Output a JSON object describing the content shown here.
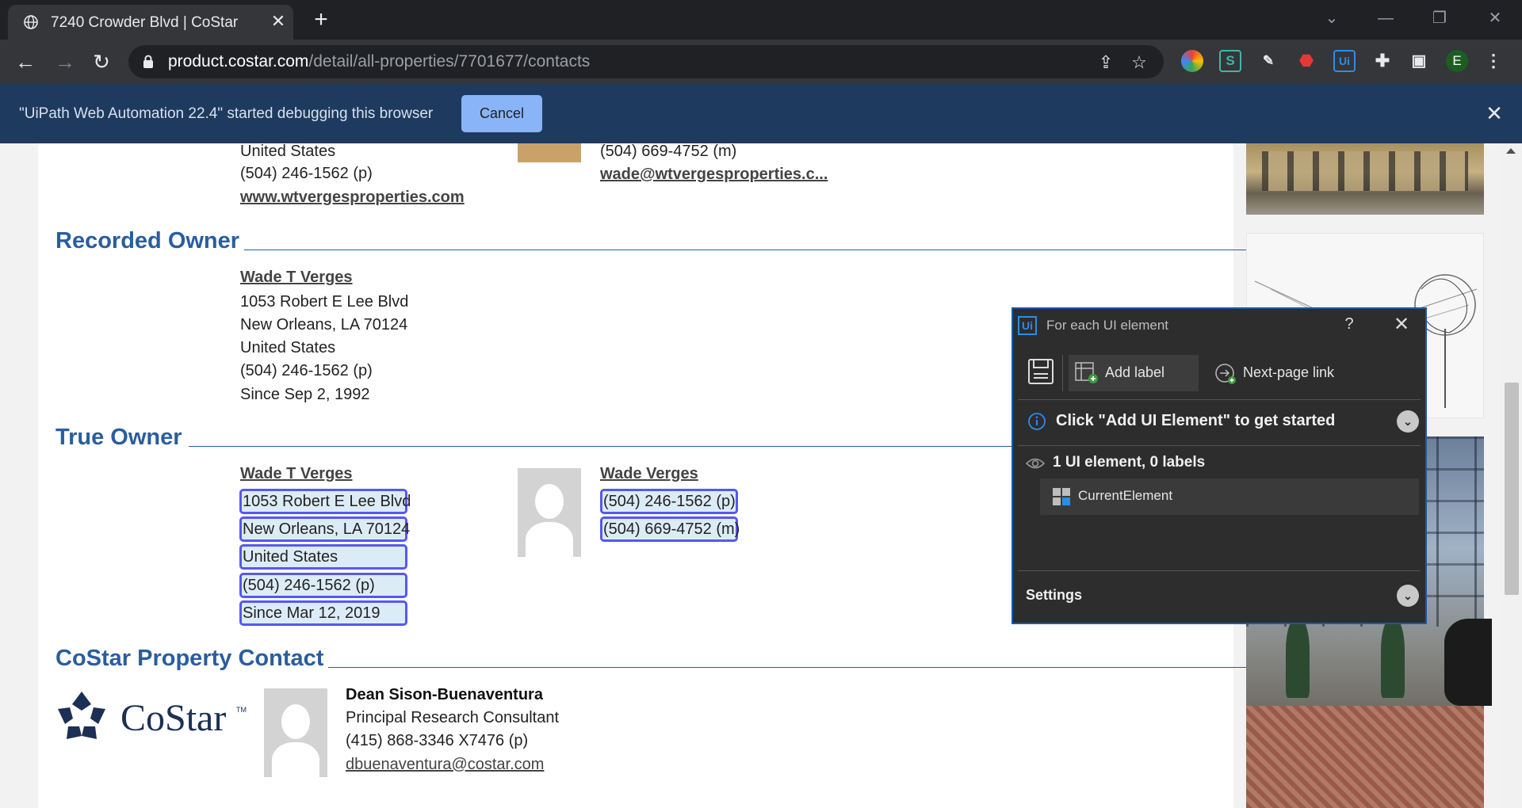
{
  "browser": {
    "tab_title": "7240 Crowder Blvd | CoStar",
    "url_host": "product.costar.com",
    "url_path": "/detail/all-properties/7701677/contacts",
    "infobar_message": "\"UiPath Web Automation 22.4\" started debugging this browser",
    "infobar_cancel": "Cancel",
    "extensions": {
      "s_label": "S",
      "ui_label": "Ui",
      "profile_initial": "E"
    }
  },
  "top_section": {
    "country": "United States",
    "phone": "(504) 246-1562 (p)",
    "website": "www.wtvergesproperties.com",
    "contact_phone_m": "(504) 669-4752 (m)",
    "contact_email": "wade@wtvergesproperties.c..."
  },
  "recorded_owner": {
    "heading": "Recorded Owner",
    "name": "Wade T Verges",
    "address1": "1053 Robert E Lee Blvd",
    "address2": "New Orleans, LA 70124",
    "country": "United States",
    "phone": "(504) 246-1562 (p)",
    "since": "Since Sep 2, 1992"
  },
  "true_owner": {
    "heading": "True Owner",
    "name": "Wade T Verges",
    "address1": "1053 Robert E Lee Blvd",
    "address2": "New Orleans, LA 70124",
    "country": "United States",
    "phone": "(504) 246-1562 (p)",
    "since": "Since Mar 12, 2019",
    "contact_name": "Wade Verges",
    "contact_phone_p": "(504) 246-1562 (p)",
    "contact_phone_m": "(504) 669-4752 (m)"
  },
  "costar_contact": {
    "heading": "CoStar Property Contact",
    "logo_text": "CoStar",
    "logo_tm": "TM",
    "name": "Dean Sison-Buenaventura",
    "title": "Principal Research Consultant",
    "phone": "(415) 868-3346 X7476 (p)",
    "email": "dbuenaventura@costar.com"
  },
  "uipath_panel": {
    "title": "For each UI element",
    "help": "?",
    "add_label": "Add label",
    "next_page_link": "Next-page link",
    "info_message": "Click \"Add UI Element\" to get started",
    "summary": "1 UI element, 0 labels",
    "element_name": "CurrentElement",
    "settings": "Settings"
  }
}
